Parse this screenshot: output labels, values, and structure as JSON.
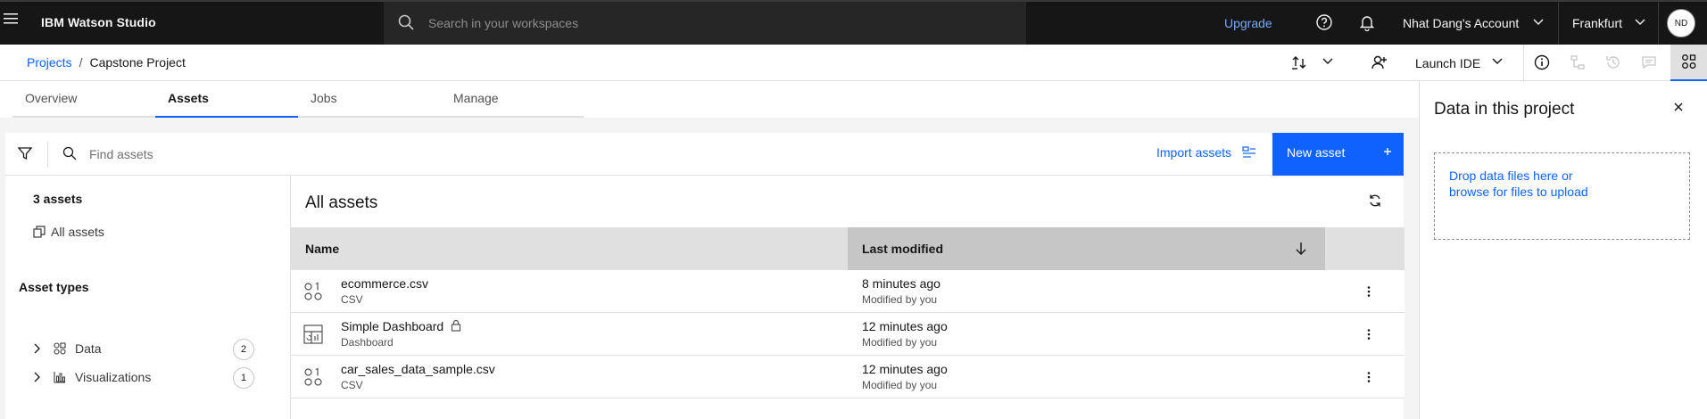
{
  "topbar": {
    "brand": "IBM Watson Studio",
    "search_placeholder": "Search in your workspaces",
    "upgrade_label": "Upgrade",
    "account_label": "Nhat Dang's Account",
    "region_label": "Frankfurt",
    "avatar_initials": "ND"
  },
  "breadcrumb": {
    "projects": "Projects",
    "separator": "/",
    "current": "Capstone Project"
  },
  "header": {
    "launch_ide_label": "Launch IDE"
  },
  "tabs": [
    {
      "label": "Overview"
    },
    {
      "label": "Assets"
    },
    {
      "label": "Jobs"
    },
    {
      "label": "Manage"
    }
  ],
  "toolbar": {
    "find_placeholder": "Find assets",
    "import_label": "Import assets",
    "new_asset_label": "New asset"
  },
  "filters": {
    "count_label": "3 assets",
    "all_assets_label": "All assets",
    "asset_types_label": "Asset types",
    "types": [
      {
        "label": "Data",
        "count": "2"
      },
      {
        "label": "Visualizations",
        "count": "1"
      }
    ]
  },
  "assets": {
    "title": "All assets",
    "columns": {
      "name": "Name",
      "modified": "Last modified"
    },
    "rows": [
      {
        "name": "ecommerce.csv",
        "type": "CSV",
        "modified": "8 minutes ago",
        "modified_by": "Modified by you",
        "icon": "data-icon",
        "locked": false
      },
      {
        "name": "Simple Dashboard",
        "type": "Dashboard",
        "modified": "12 minutes ago",
        "modified_by": "Modified by you",
        "icon": "dashboard-icon",
        "locked": true
      },
      {
        "name": "car_sales_data_sample.csv",
        "type": "CSV",
        "modified": "12 minutes ago",
        "modified_by": "Modified by you",
        "icon": "data-icon",
        "locked": false
      }
    ]
  },
  "data_panel": {
    "title": "Data in this project",
    "drop_line1": "Drop data files here or",
    "drop_line2": "browse for files to upload"
  },
  "colors": {
    "topbar_bg": "#161616",
    "primary": "#0f62fe",
    "link_on_dark": "#78a9ff"
  }
}
